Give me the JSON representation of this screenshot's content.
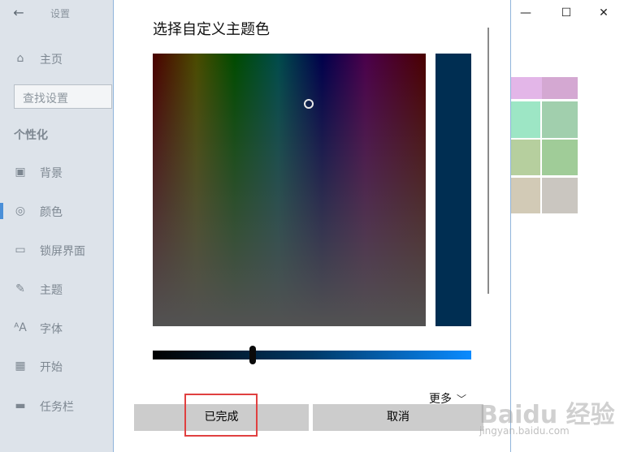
{
  "settings_window": {
    "title": "设置",
    "back_icon": "←",
    "controls": {
      "minimize": "—",
      "maximize": "☐",
      "close": "✕"
    },
    "search": {
      "placeholder": "查找设置"
    },
    "section_heading": "个性化",
    "home": {
      "label": "主页",
      "icon": "⌂",
      "icon_name": "home-icon"
    },
    "nav_items": [
      {
        "label": "背景",
        "icon": "▣",
        "icon_name": "picture-icon"
      },
      {
        "label": "颜色",
        "icon": "◎",
        "icon_name": "palette-icon"
      },
      {
        "label": "锁屏界面",
        "icon": "▭",
        "icon_name": "lock-screen-icon"
      },
      {
        "label": "主题",
        "icon": "✎",
        "icon_name": "theme-icon"
      },
      {
        "label": "字体",
        "icon": "ᴬA",
        "icon_name": "font-icon"
      },
      {
        "label": "开始",
        "icon": "▦",
        "icon_name": "start-icon"
      },
      {
        "label": "任务栏",
        "icon": "▬",
        "icon_name": "taskbar-icon"
      }
    ],
    "selected_nav": "颜色",
    "swatches": [
      "#e3b6e8",
      "#d4a8d2",
      "#9de6c5",
      "#a1cfad",
      "#b6cf9e",
      "#a0cc98",
      "#d2cab6",
      "#cac6c0"
    ]
  },
  "dialog": {
    "title": "选择自定义主题色",
    "selected_color": "#002e52",
    "more_label": "更多",
    "more_icon": "﹀",
    "done_label": "已完成",
    "cancel_label": "取消"
  },
  "watermark": {
    "logo": "Baidu 经验",
    "url": "jingyan.baidu.com"
  }
}
